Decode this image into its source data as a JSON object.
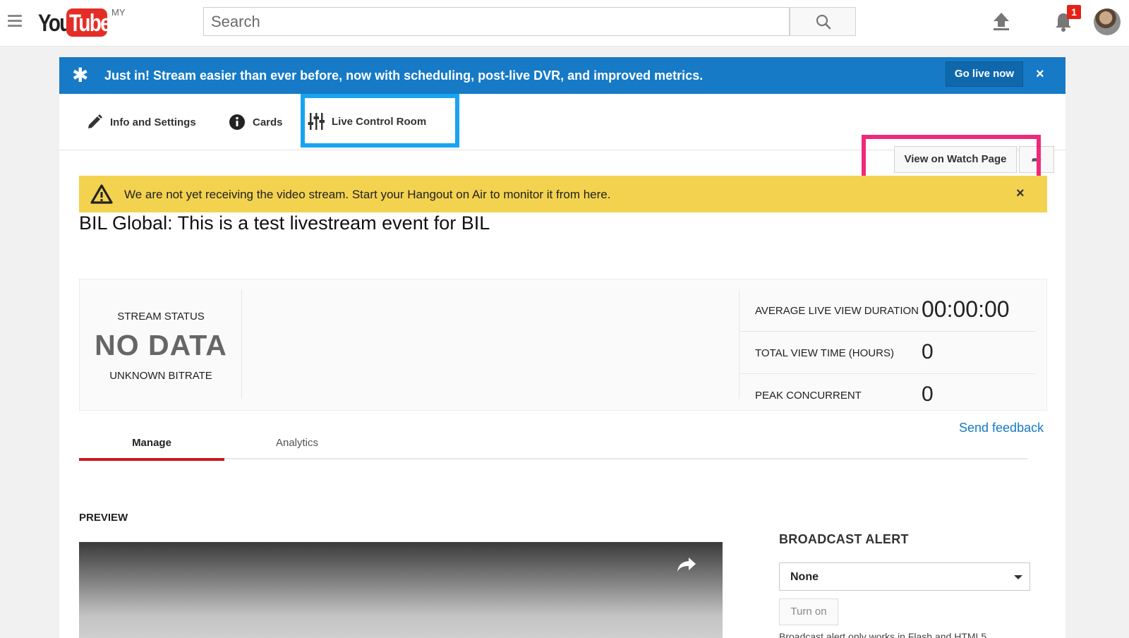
{
  "header": {
    "logo_you": "You",
    "logo_tube": "Tube",
    "region": "MY",
    "search_placeholder": "Search",
    "notification_count": "1"
  },
  "promo": {
    "text": "Just in! Stream easier than ever before, now with scheduling, post-live DVR, and improved metrics.",
    "go_live_label": "Go live now",
    "close": "×"
  },
  "tabs": {
    "info_settings": "Info and Settings",
    "cards": "Cards",
    "live_control_room": "Live Control Room",
    "view_watch_page": "View on Watch Page"
  },
  "warning": {
    "text": "We are not yet receiving the video stream. Start your Hangout on Air to monitor it from here.",
    "close": "×"
  },
  "event": {
    "title": "BIL Global: This is a test livestream event for BIL"
  },
  "stats": {
    "stream_status_label": "STREAM STATUS",
    "status_value": "NO DATA",
    "bitrate": "UNKNOWN BITRATE",
    "metrics": [
      {
        "label": "AVERAGE LIVE VIEW DURATION",
        "value": "00:00:00"
      },
      {
        "label": "TOTAL VIEW TIME (HOURS)",
        "value": "0"
      },
      {
        "label": "PEAK CONCURRENT",
        "value": "0"
      }
    ]
  },
  "feedback_label": "Send feedback",
  "sub_tabs": {
    "manage": "Manage",
    "analytics": "Analytics"
  },
  "preview_label": "PREVIEW",
  "broadcast_alert": {
    "title": "BROADCAST ALERT",
    "selected": "None",
    "turn_on": "Turn on",
    "note": "Broadcast alert only works in Flash and HTML5"
  },
  "colors": {
    "brand_red": "#e52d27",
    "promo_blue": "#167ac6",
    "warning_yellow": "#f3d24f",
    "highlight_blue": "#1aa3f0",
    "highlight_pink": "#ee2a7b"
  }
}
